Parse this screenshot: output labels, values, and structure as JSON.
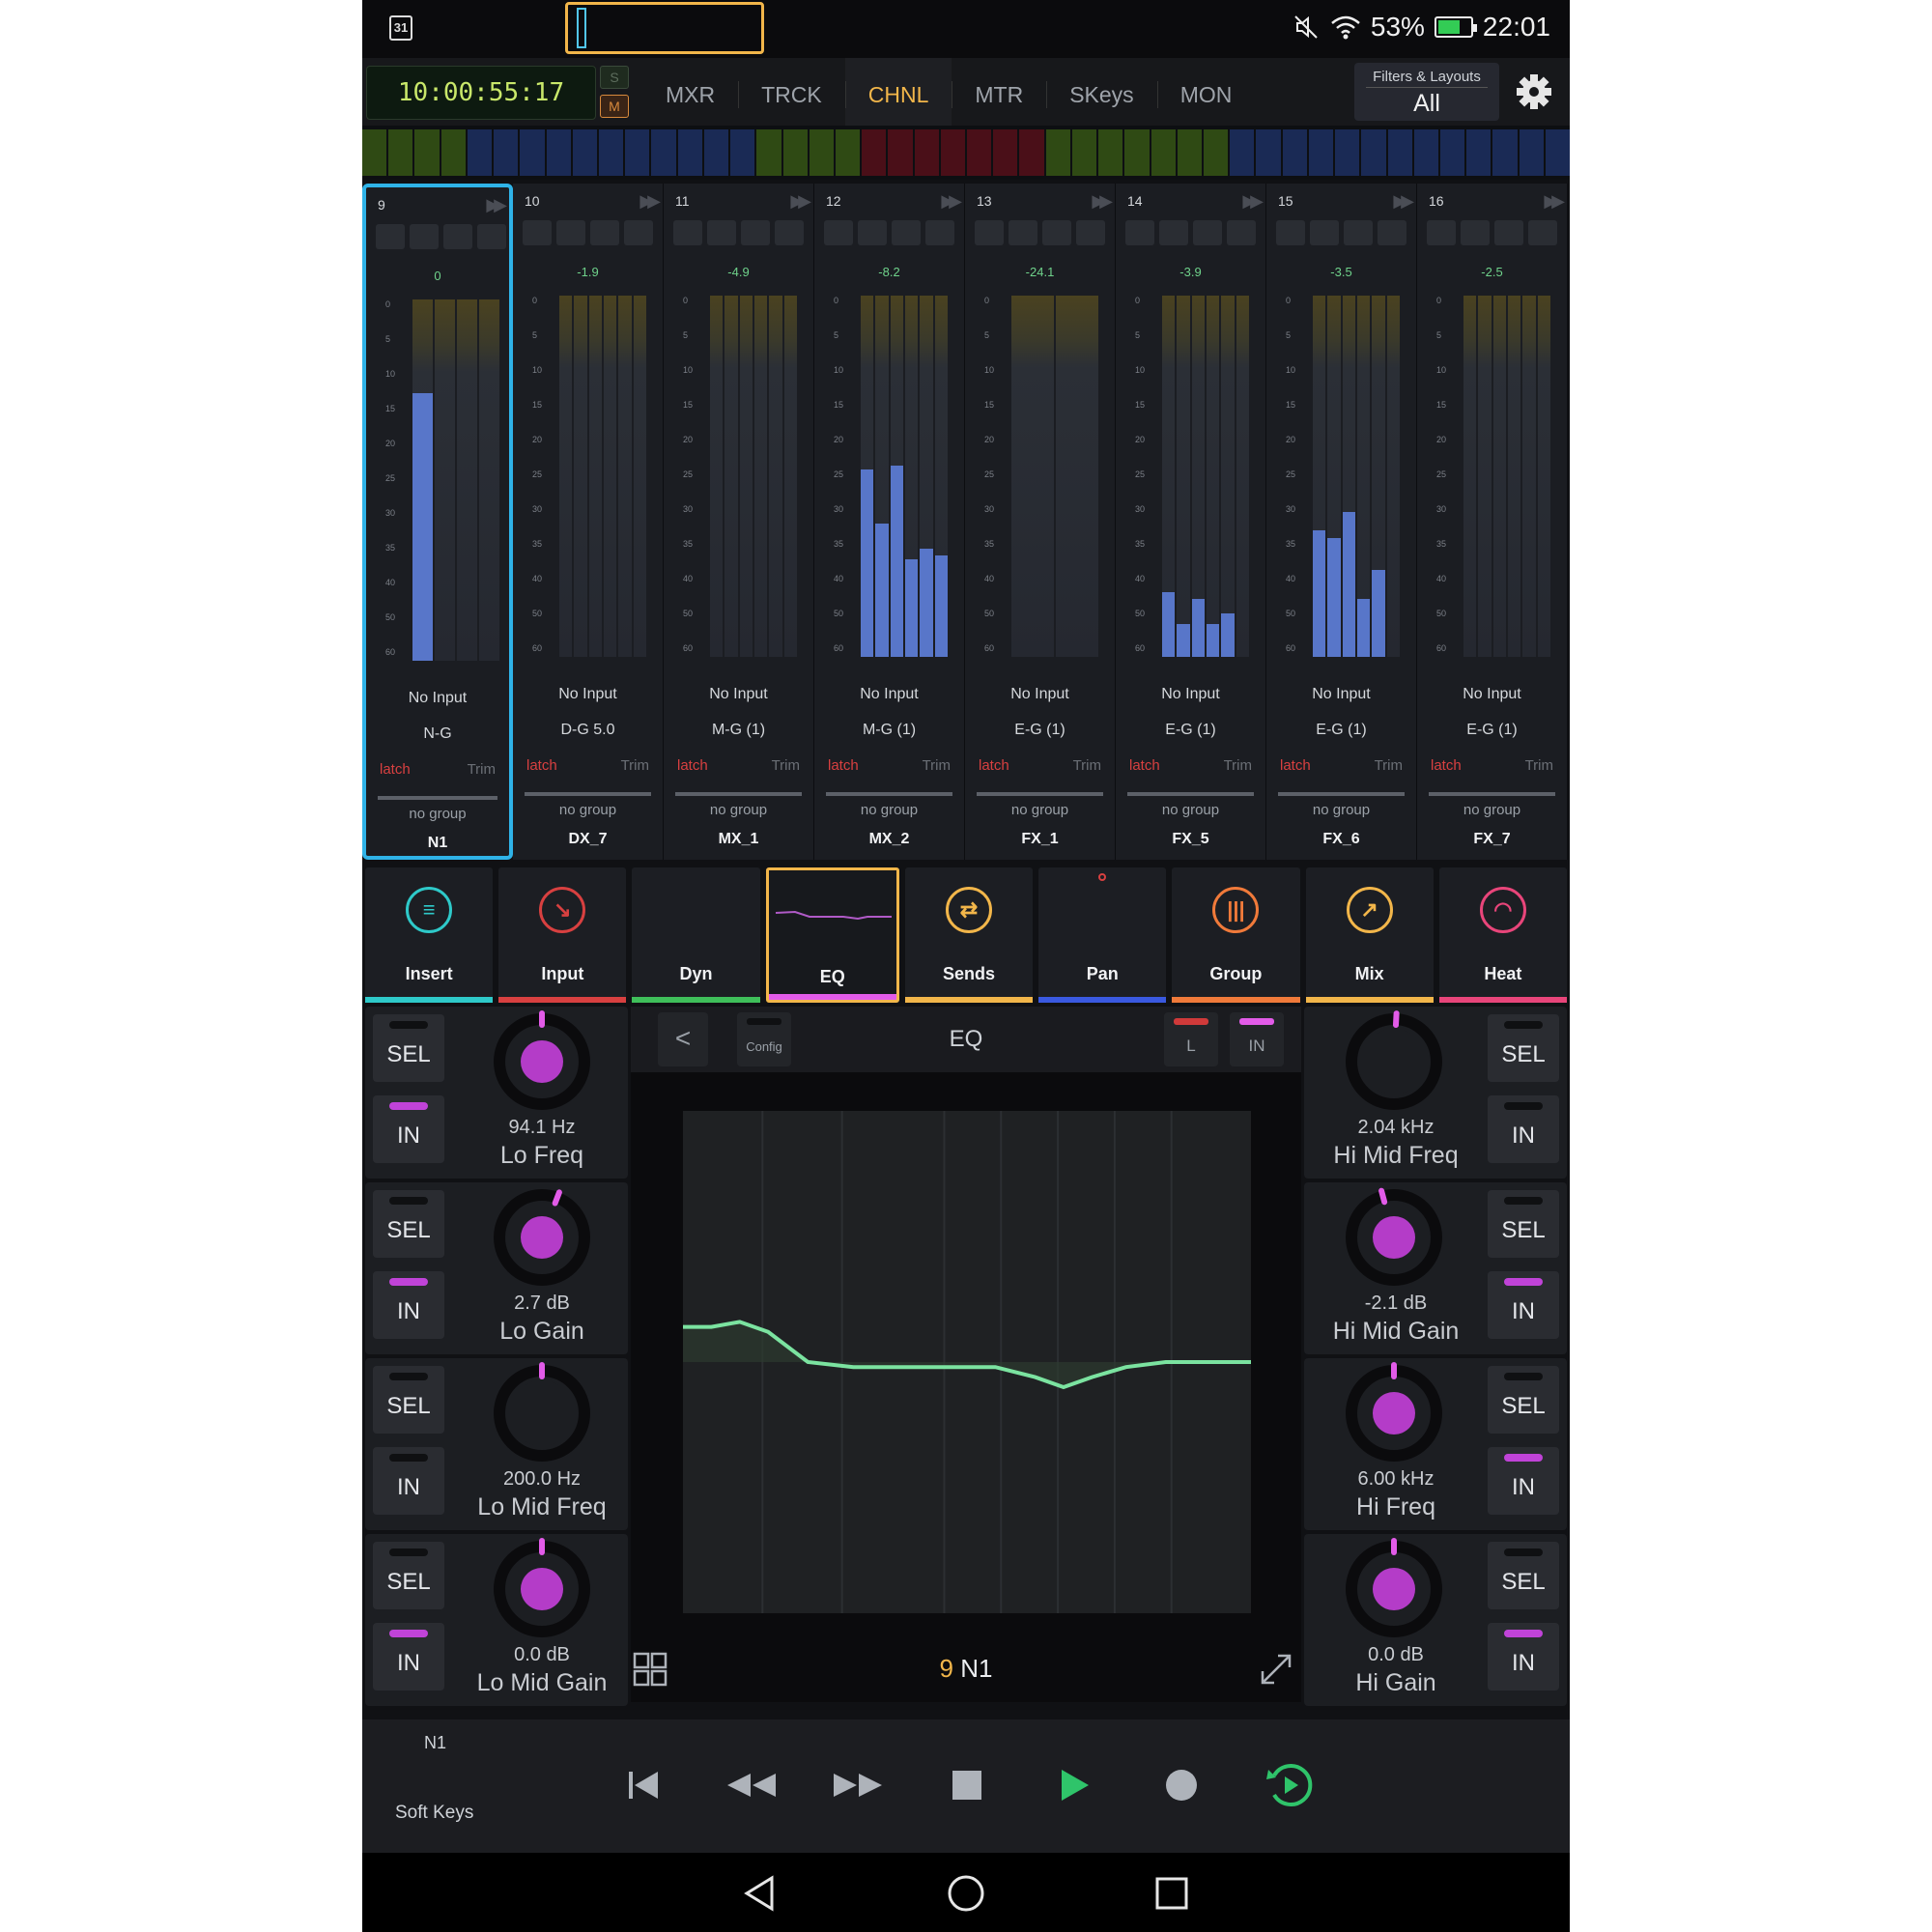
{
  "status": {
    "calendar": "31",
    "battery": "53%",
    "time": "22:01"
  },
  "transport_header": {
    "timecode": "10:00:55:17",
    "solo": "S",
    "mute": "M"
  },
  "tabs": [
    {
      "label": "MXR"
    },
    {
      "label": "TRCK"
    },
    {
      "label": "CHNL",
      "active": true
    },
    {
      "label": "MTR"
    },
    {
      "label": "SKeys"
    },
    {
      "label": "MON"
    }
  ],
  "filters": {
    "title": "Filters & Layouts",
    "value": "All"
  },
  "overview_colors": [
    "#2f4a14",
    "#2f4a14",
    "#2f4a14",
    "#2f4a14",
    "#1a2a55",
    "#1a2a55",
    "#1a2a55",
    "#1a2a55",
    "#1a2a55",
    "#1a2a55",
    "#1a2a55",
    "#1a2a55",
    "#1a2a55",
    "#1a2a55",
    "#1a2a55",
    "#2f4a14",
    "#2f4a14",
    "#2f4a14",
    "#2f4a14",
    "#4a0f18",
    "#4a0f18",
    "#4a0f18",
    "#4a0f18",
    "#4a0f18",
    "#4a0f18",
    "#4a0f18",
    "#2f4a14",
    "#2f4a14",
    "#2f4a14",
    "#2f4a14",
    "#2f4a14",
    "#2f4a14",
    "#2f4a14",
    "#1a2a55",
    "#1a2a55",
    "#1a2a55",
    "#1a2a55",
    "#1a2a55",
    "#1a2a55",
    "#1a2a55",
    "#1a2a55",
    "#1a2a55",
    "#1a2a55",
    "#1a2a55",
    "#1a2a55",
    "#1a2a55"
  ],
  "meter_scale": [
    "0",
    "5",
    "10",
    "15",
    "20",
    "25",
    "30",
    "35",
    "40",
    "50",
    "60"
  ],
  "strips": [
    {
      "num": "9",
      "db": "0",
      "input": "No Input",
      "group": "N-G",
      "latch": "latch",
      "trim": "Trim",
      "nogroup": "no group",
      "name": "N1",
      "levels": [
        0.74,
        0,
        0,
        0
      ],
      "selected": true
    },
    {
      "num": "10",
      "db": "-1.9",
      "input": "No Input",
      "group": "D-G 5.0",
      "latch": "latch",
      "trim": "Trim",
      "nogroup": "no group",
      "name": "DX_7",
      "levels": [
        0,
        0,
        0,
        0,
        0,
        0
      ]
    },
    {
      "num": "11",
      "db": "-4.9",
      "input": "No Input",
      "group": "M-G (1)",
      "latch": "latch",
      "trim": "Trim",
      "nogroup": "no group",
      "name": "MX_1",
      "levels": [
        0,
        0,
        0,
        0,
        0,
        0
      ]
    },
    {
      "num": "12",
      "db": "-8.2",
      "input": "No Input",
      "group": "M-G (1)",
      "latch": "latch",
      "trim": "Trim",
      "nogroup": "no group",
      "name": "MX_2",
      "levels": [
        0.52,
        0.37,
        0.53,
        0.27,
        0.3,
        0.28
      ]
    },
    {
      "num": "13",
      "db": "-24.1",
      "input": "No Input",
      "group": "E-G (1)",
      "latch": "latch",
      "trim": "Trim",
      "nogroup": "no group",
      "name": "FX_1",
      "levels": [
        0,
        0
      ]
    },
    {
      "num": "14",
      "db": "-3.9",
      "input": "No Input",
      "group": "E-G (1)",
      "latch": "latch",
      "trim": "Trim",
      "nogroup": "no group",
      "name": "FX_5",
      "levels": [
        0.18,
        0.09,
        0.16,
        0.09,
        0.12,
        0.0
      ]
    },
    {
      "num": "15",
      "db": "-3.5",
      "input": "No Input",
      "group": "E-G (1)",
      "latch": "latch",
      "trim": "Trim",
      "nogroup": "no group",
      "name": "FX_6",
      "levels": [
        0.35,
        0.33,
        0.4,
        0.16,
        0.24,
        0.0
      ]
    },
    {
      "num": "16",
      "db": "-2.5",
      "input": "No Input",
      "group": "E-G (1)",
      "latch": "latch",
      "trim": "Trim",
      "nogroup": "no group",
      "name": "FX_7",
      "levels": [
        0,
        0,
        0,
        0,
        0,
        0
      ]
    }
  ],
  "sections": [
    {
      "label": "Insert",
      "icon": "list-icon",
      "color": "#2ec9c9",
      "glyph": "≡"
    },
    {
      "label": "Input",
      "icon": "input-icon",
      "color": "#d84040",
      "glyph": "↘"
    },
    {
      "label": "Dyn",
      "icon": "",
      "color": "#3fbf5a",
      "glyph": ""
    },
    {
      "label": "EQ",
      "icon": "",
      "color": "#e25be8",
      "glyph": ""
    },
    {
      "label": "Sends",
      "icon": "sends-icon",
      "color": "#f2b64a",
      "glyph": "⇄"
    },
    {
      "label": "Pan",
      "icon": "",
      "color": "#3a59e0",
      "glyph": ""
    },
    {
      "label": "Group",
      "icon": "group-icon",
      "color": "#f07a3a",
      "glyph": "|||"
    },
    {
      "label": "Mix",
      "icon": "mix-icon",
      "color": "#f2b64a",
      "glyph": "↗"
    },
    {
      "label": "Heat",
      "icon": "heat-icon",
      "color": "#e8457a",
      "glyph": "◠"
    }
  ],
  "eq": {
    "back": "<",
    "config": "Config",
    "title": "EQ",
    "l": "L",
    "in": "IN",
    "channel_num": "9",
    "channel_name": "N1"
  },
  "bands_left": [
    {
      "value": "94.1 Hz",
      "name": "Lo Freq",
      "sel": "SEL",
      "in": "IN",
      "in_on": true,
      "fill": true,
      "dial": 0.5
    },
    {
      "value": "2.7 dB",
      "name": "Lo Gain",
      "sel": "SEL",
      "in": "IN",
      "in_on": true,
      "fill": true,
      "dial": 0.57
    },
    {
      "value": "200.0 Hz",
      "name": "Lo Mid Freq",
      "sel": "SEL",
      "in": "IN",
      "in_on": false,
      "fill": false,
      "dial": 0.5
    },
    {
      "value": "0.0 dB",
      "name": "Lo Mid Gain",
      "sel": "SEL",
      "in": "IN",
      "in_on": true,
      "fill": true,
      "dial": 0.5
    }
  ],
  "bands_right": [
    {
      "value": "2.04 kHz",
      "name": "Hi Mid Freq",
      "sel": "SEL",
      "in": "IN",
      "in_on": false,
      "fill": false,
      "dial": 0.51
    },
    {
      "value": "-2.1 dB",
      "name": "Hi Mid Gain",
      "sel": "SEL",
      "in": "IN",
      "in_on": true,
      "fill": true,
      "dial": 0.45
    },
    {
      "value": "6.00 kHz",
      "name": "Hi Freq",
      "sel": "SEL",
      "in": "IN",
      "in_on": true,
      "fill": true,
      "dial": 0.5
    },
    {
      "value": "0.0 dB",
      "name": "Hi Gain",
      "sel": "SEL",
      "in": "IN",
      "in_on": true,
      "fill": true,
      "dial": 0.5
    }
  ],
  "eq_curve": {
    "color": "#7be3a0",
    "points": [
      [
        0,
        0.43
      ],
      [
        0.05,
        0.43
      ],
      [
        0.1,
        0.42
      ],
      [
        0.15,
        0.44
      ],
      [
        0.22,
        0.5
      ],
      [
        0.3,
        0.51
      ],
      [
        0.45,
        0.51
      ],
      [
        0.55,
        0.51
      ],
      [
        0.62,
        0.53
      ],
      [
        0.67,
        0.55
      ],
      [
        0.72,
        0.53
      ],
      [
        0.78,
        0.51
      ],
      [
        0.85,
        0.5
      ],
      [
        0.9,
        0.5
      ],
      [
        1,
        0.5
      ]
    ]
  },
  "transport": {
    "selected": "N1",
    "soft_keys": "Soft Keys"
  }
}
